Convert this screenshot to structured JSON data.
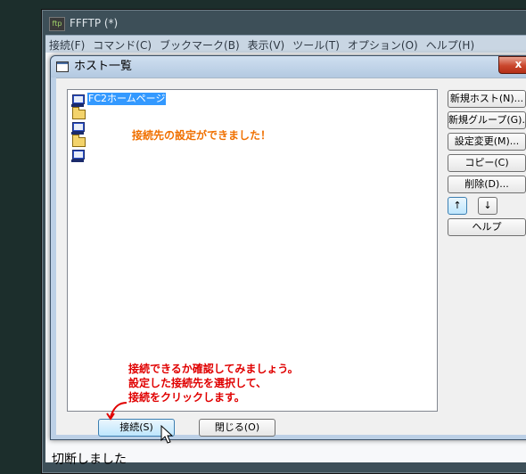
{
  "app": {
    "title": "FFFTP (*)",
    "icon_text": "ftp",
    "menu": [
      "接続(F)",
      "コマンド(C)",
      "ブックマーク(B)",
      "表示(V)",
      "ツール(T)",
      "オプション(O)",
      "ヘルプ(H)"
    ],
    "status_text": "切断しました"
  },
  "dialog": {
    "title": "ホスト一覧",
    "close_label": "x",
    "tree": {
      "items": [
        {
          "type": "host",
          "label": "FC2ホームページ",
          "selected": true
        },
        {
          "type": "folder",
          "label": ""
        },
        {
          "type": "host",
          "label": ""
        },
        {
          "type": "folder",
          "label": ""
        },
        {
          "type": "host",
          "label": ""
        }
      ]
    },
    "side_buttons": {
      "new_host": "新規ホスト(N)...",
      "new_group": "新規グループ(G)...",
      "edit_settings": "設定変更(M)...",
      "copy": "コピー(C)",
      "delete": "削除(D)...",
      "move_up": "↑",
      "move_down": "↓",
      "help": "ヘルプ"
    },
    "bottom_buttons": {
      "connect": "接続(S)",
      "close": "閉じる(O)"
    }
  },
  "annotations": {
    "done": "接続先の設定ができました！",
    "instruction": [
      "接続できるか確認してみましょう。",
      "設定した接続先を選択して、",
      "接続をクリックします。"
    ]
  },
  "colors": {
    "selection": "#3399ff",
    "annotation_orange": "#f07000",
    "annotation_red": "#e00000",
    "close_button": "#c9462c"
  }
}
